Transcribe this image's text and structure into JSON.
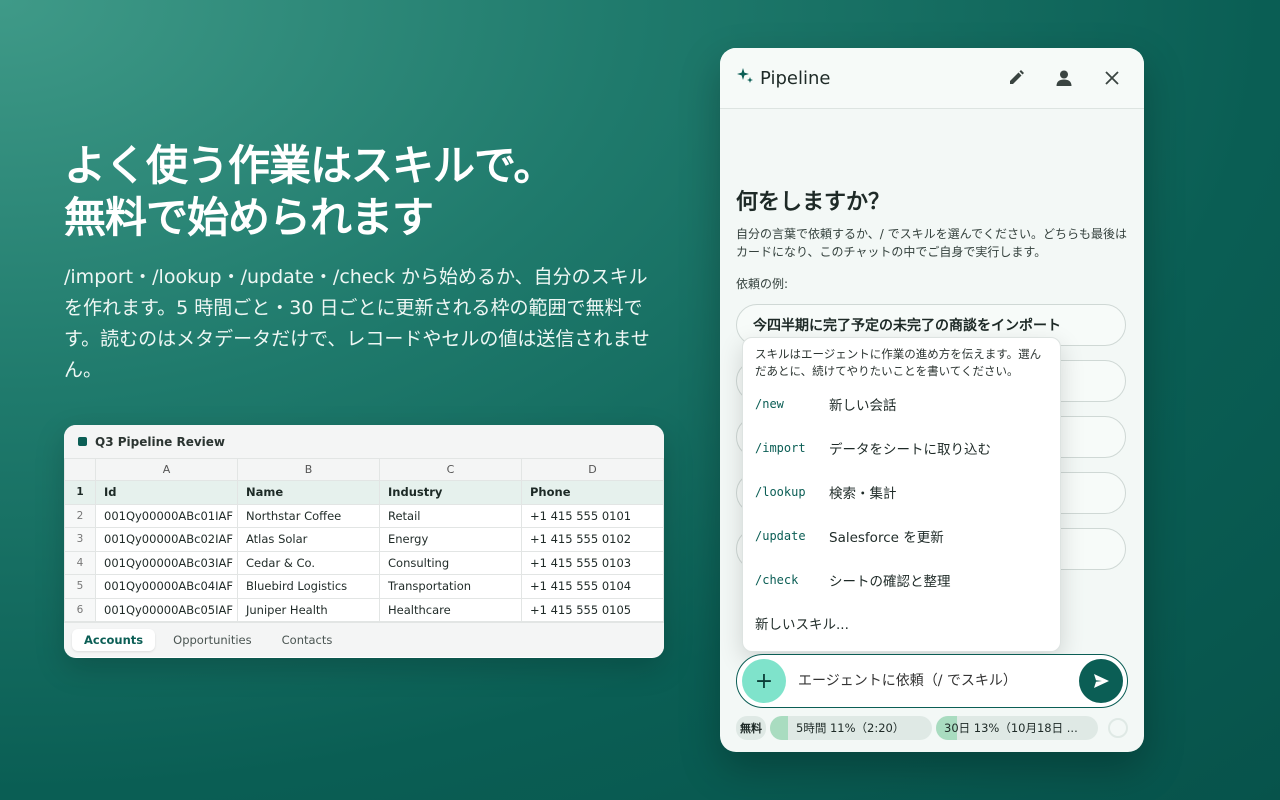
{
  "hero": {
    "headline_line1": "よく使う作業はスキルで。",
    "headline_line2": "無料で始められます",
    "subcopy": "/import・/lookup・/update・/check から始めるか、自分のスキルを作れます。5 時間ごと・30 日ごとに更新される枠の範囲で無料です。読むのはメタデータだけで、レコードやセルの値は送信されません。"
  },
  "sheet": {
    "title": "Q3 Pipeline Review",
    "columns": [
      "A",
      "B",
      "C",
      "D"
    ],
    "header_row": {
      "num": "1",
      "cells": [
        "Id",
        "Name",
        "Industry",
        "Phone"
      ]
    },
    "rows": [
      {
        "num": "2",
        "cells": [
          "001Qy00000ABc01IAF",
          "Northstar Coffee",
          "Retail",
          "+1 415 555 0101"
        ]
      },
      {
        "num": "3",
        "cells": [
          "001Qy00000ABc02IAF",
          "Atlas Solar",
          "Energy",
          "+1 415 555 0102"
        ]
      },
      {
        "num": "4",
        "cells": [
          "001Qy00000ABc03IAF",
          "Cedar & Co.",
          "Consulting",
          "+1 415 555 0103"
        ]
      },
      {
        "num": "5",
        "cells": [
          "001Qy00000ABc04IAF",
          "Bluebird Logistics",
          "Transportation",
          "+1 415 555 0104"
        ]
      },
      {
        "num": "6",
        "cells": [
          "001Qy00000ABc05IAF",
          "Juniper Health",
          "Healthcare",
          "+1 415 555 0105"
        ]
      }
    ],
    "tabs": [
      "Accounts",
      "Opportunities",
      "Contacts"
    ],
    "active_tab": "Accounts"
  },
  "panel": {
    "title": "Pipeline",
    "icons": [
      "sparkle-icon",
      "pencil-icon",
      "person-icon",
      "close-icon"
    ],
    "question": "何をしますか？",
    "description": "自分の言葉で依頼するか、/ でスキルを選んでください。どちらも最後はカードになり、このチャットの中でご自身で実行します。",
    "examples_label": "依頼の例:",
    "example_first": "今四半期に完了予定の未完了の商談をインポート"
  },
  "skill_menu": {
    "hint": "スキルはエージェントに作業の進め方を伝えます。選んだあとに、続けてやりたいことを書いてください。",
    "skills": [
      {
        "cmd": "/new",
        "label": "新しい会話"
      },
      {
        "cmd": "/import",
        "label": "データをシートに取り込む"
      },
      {
        "cmd": "/lookup",
        "label": "検索・集計"
      },
      {
        "cmd": "/update",
        "label": "Salesforce を更新"
      },
      {
        "cmd": "/check",
        "label": "シートの確認と整理"
      }
    ],
    "new_skill": "新しいスキル..."
  },
  "composer": {
    "placeholder": "エージェントに依頼（/ でスキル）",
    "plus": "+"
  },
  "usage": {
    "plan": "無料",
    "five_hour_label": "5時間 11%（2:20）",
    "five_hour_fraction": 0.11,
    "thirty_day_label": "30日 13%（10月18日 ...",
    "thirty_day_fraction": 0.13
  },
  "colors": {
    "brand": "#0b5e55",
    "accent": "#7fe3cb",
    "meter_fill": "#a9dcc0"
  }
}
